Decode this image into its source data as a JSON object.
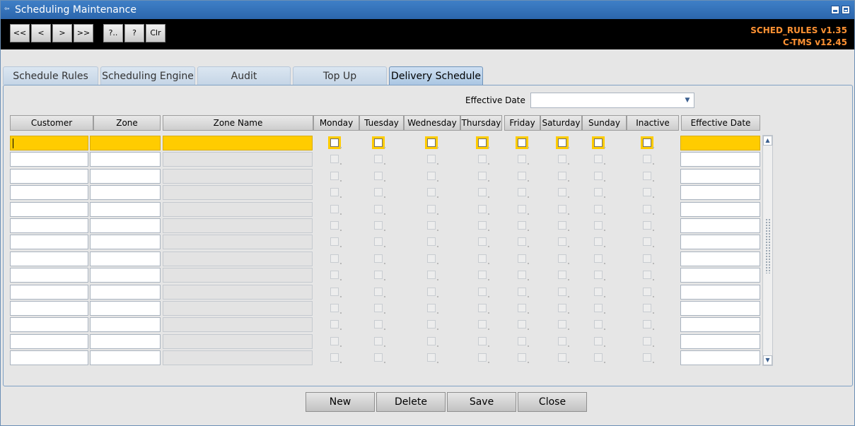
{
  "window": {
    "title": "Scheduling Maintenance"
  },
  "toolbar": {
    "first": "<<",
    "prev": "<",
    "next": ">",
    "last": ">>",
    "query": "?..",
    "help": "?",
    "clear": "Clr",
    "version_form": "SCHED_RULES v1.35",
    "version_app": "C-TMS v12.45"
  },
  "tabs": [
    {
      "label": "Schedule Rules"
    },
    {
      "label": "Scheduling Engine"
    },
    {
      "label": "Audit"
    },
    {
      "label": "Top Up"
    },
    {
      "label": "Delivery Schedule",
      "active": true
    }
  ],
  "filter": {
    "effective_date_label": "Effective Date",
    "effective_date_value": ""
  },
  "grid": {
    "columns": {
      "customer": "Customer",
      "zone": "Zone",
      "zone_name": "Zone Name",
      "monday": "Monday",
      "tuesday": "Tuesday",
      "wednesday": "Wednesday",
      "thursday": "Thursday",
      "friday": "Friday",
      "saturday": "Saturday",
      "sunday": "Sunday",
      "inactive": "Inactive",
      "effective_date": "Effective Date"
    },
    "row_count": 14,
    "current_row": 1
  },
  "buttons": {
    "new": "New",
    "delete": "Delete",
    "save": "Save",
    "close": "Close"
  },
  "colors": {
    "current_row": "#ffcc00",
    "title_bar": "#2b66ad",
    "version_text": "#ff9233"
  },
  "icons": [
    "app-icon",
    "minimize-icon",
    "maximize-icon",
    "dropdown-arrow-icon",
    "scroll-up-icon",
    "scroll-down-icon"
  ]
}
